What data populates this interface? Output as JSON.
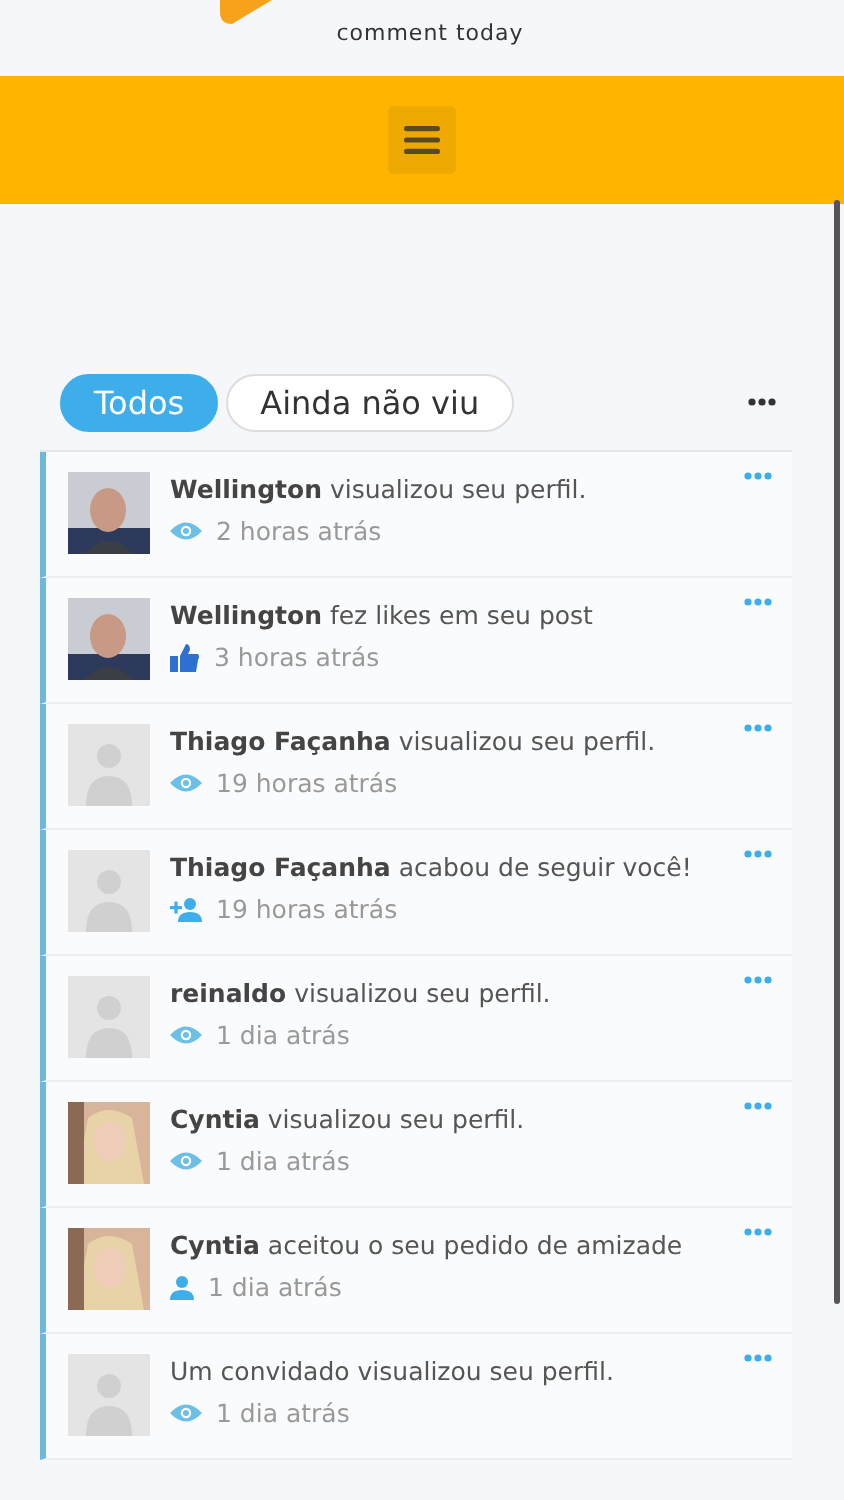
{
  "header": {
    "tagline": "comment today"
  },
  "tabs": [
    {
      "label": "Todos",
      "selected": true
    },
    {
      "label": "Ainda não viu",
      "selected": false
    }
  ],
  "notifications": [
    {
      "name": "Wellington",
      "action": "visualizou seu perfil.",
      "time": "2 horas atrás",
      "kind": "view",
      "has_photo": true
    },
    {
      "name": "Wellington",
      "action": "fez likes em seu post",
      "time": "3 horas atrás",
      "kind": "like",
      "has_photo": true
    },
    {
      "name": "Thiago Façanha",
      "action": "visualizou seu perfil.",
      "time": "19 horas atrás",
      "kind": "view",
      "has_photo": false
    },
    {
      "name": "Thiago Façanha",
      "action": "acabou de seguir você!",
      "time": "19 horas atrás",
      "kind": "follow",
      "has_photo": false
    },
    {
      "name": "reinaldo",
      "action": "visualizou seu perfil.",
      "time": "1 dia atrás",
      "kind": "view",
      "has_photo": false
    },
    {
      "name": "Cyntia",
      "action": "visualizou seu perfil.",
      "time": "1 dia atrás",
      "kind": "view",
      "has_photo": true
    },
    {
      "name": "Cyntia",
      "action": "aceitou o seu pedido de amizade",
      "time": "1 dia atrás",
      "kind": "friend",
      "has_photo": true
    },
    {
      "action": "Um convidado visualizou seu perfil.",
      "time": "1 dia atrás",
      "kind": "view",
      "has_photo": false
    }
  ]
}
